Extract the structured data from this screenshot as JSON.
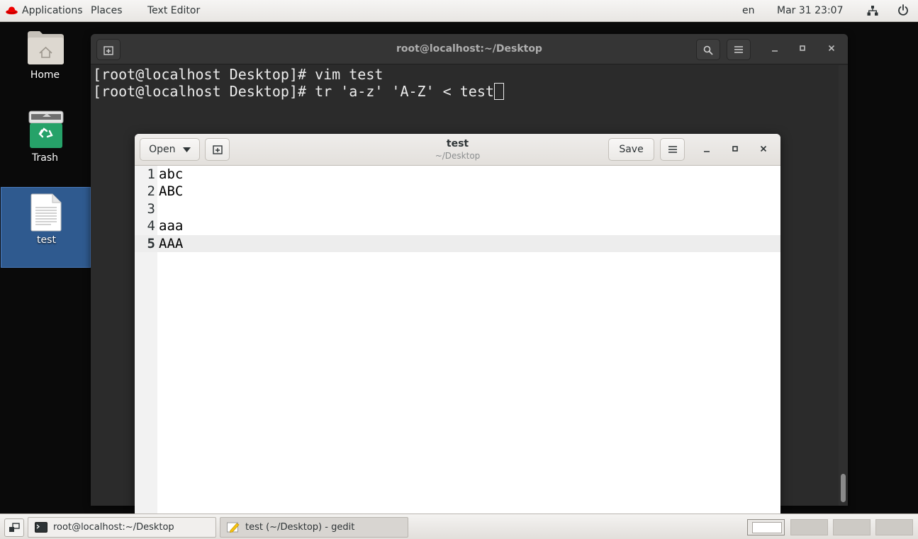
{
  "top_panel": {
    "applications": "Applications",
    "places": "Places",
    "app_name": "Text Editor",
    "language": "en",
    "clock": "Mar 31 23:07"
  },
  "desktop": {
    "icons": [
      {
        "label": "Home",
        "icon": "home-folder-icon"
      },
      {
        "label": "Trash",
        "icon": "trash-icon"
      },
      {
        "label": "test",
        "icon": "text-file-icon"
      }
    ]
  },
  "terminal": {
    "title": "root@localhost:~/Desktop",
    "lines": [
      "[root@localhost Desktop]# vim test",
      "[root@localhost Desktop]# tr 'a-z' 'A-Z' < test"
    ]
  },
  "gedit": {
    "open_label": "Open",
    "save_label": "Save",
    "title": "test",
    "subtitle": "~/Desktop",
    "lines": [
      {
        "num": "1",
        "text": "abc"
      },
      {
        "num": "2",
        "text": "ABC"
      },
      {
        "num": "3",
        "text": ""
      },
      {
        "num": "4",
        "text": "aaa"
      },
      {
        "num": "5",
        "text": "AAA"
      }
    ],
    "current_line": 5
  },
  "taskbar": {
    "tasks": [
      {
        "label": "root@localhost:~/Desktop",
        "icon": "terminal-icon"
      },
      {
        "label": "test (~/Desktop) - gedit",
        "icon": "text-editor-icon"
      }
    ],
    "workspaces": 4,
    "active_workspace": 1
  },
  "colors": {
    "accent_redhat": "#ee0000",
    "selection_blue": "#2f5a8f",
    "terminal_bg": "#2b2b2b"
  }
}
